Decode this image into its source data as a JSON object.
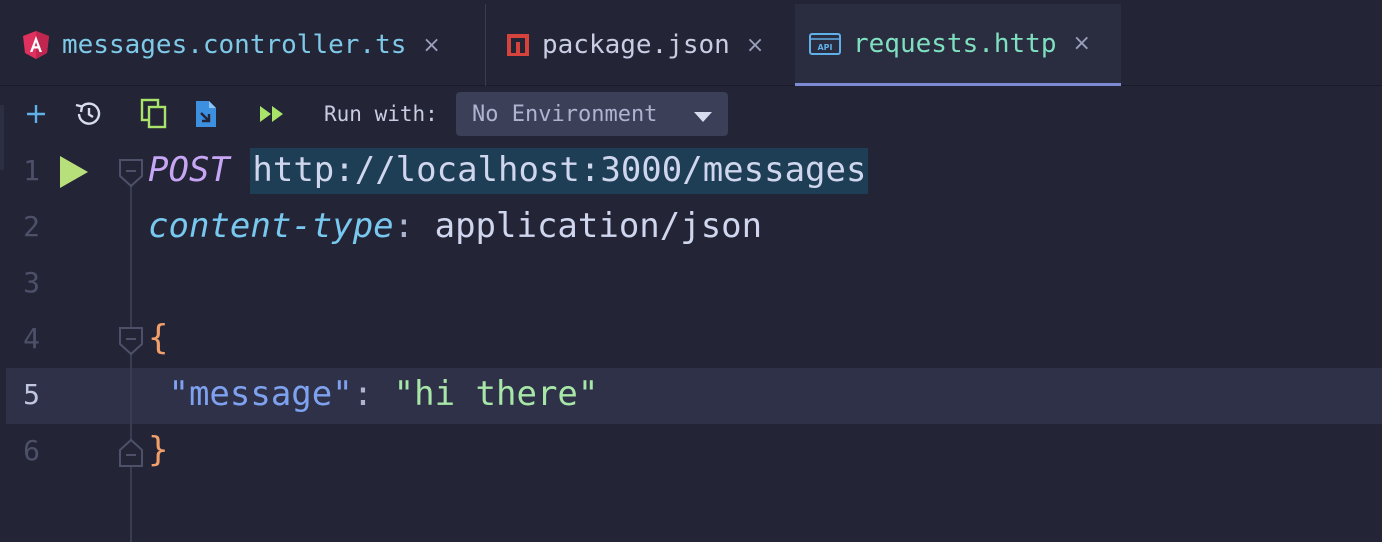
{
  "tabs": [
    {
      "label": "messages.controller.ts",
      "icon": "angular-icon",
      "active": false
    },
    {
      "label": "package.json",
      "icon": "npm-icon",
      "active": false
    },
    {
      "label": "requests.http",
      "icon": "api-icon",
      "active": true
    }
  ],
  "tab_close_glyph": "×",
  "toolbar": {
    "run_with_label": "Run with:",
    "environment": "No Environment",
    "buttons": [
      "add-request-icon",
      "history-icon",
      "copy-icon",
      "import-file-icon",
      "run-all-icon"
    ]
  },
  "editor": {
    "current_line": 5,
    "lines": [
      {
        "number": "1",
        "method": "POST",
        "url": "http://localhost:3000/messages"
      },
      {
        "number": "2",
        "header_name": "content-type",
        "separator": ":",
        "header_value": " application/json"
      },
      {
        "number": "3"
      },
      {
        "number": "4",
        "text": "{"
      },
      {
        "number": "5",
        "key": "\"message\"",
        "separator": ": ",
        "value": "\"hi there\""
      },
      {
        "number": "6",
        "text": "}"
      }
    ]
  },
  "colors": {
    "background": "#232536",
    "active_tab_underline": "#7c8bd4",
    "run_icon": "#b8e07a"
  }
}
